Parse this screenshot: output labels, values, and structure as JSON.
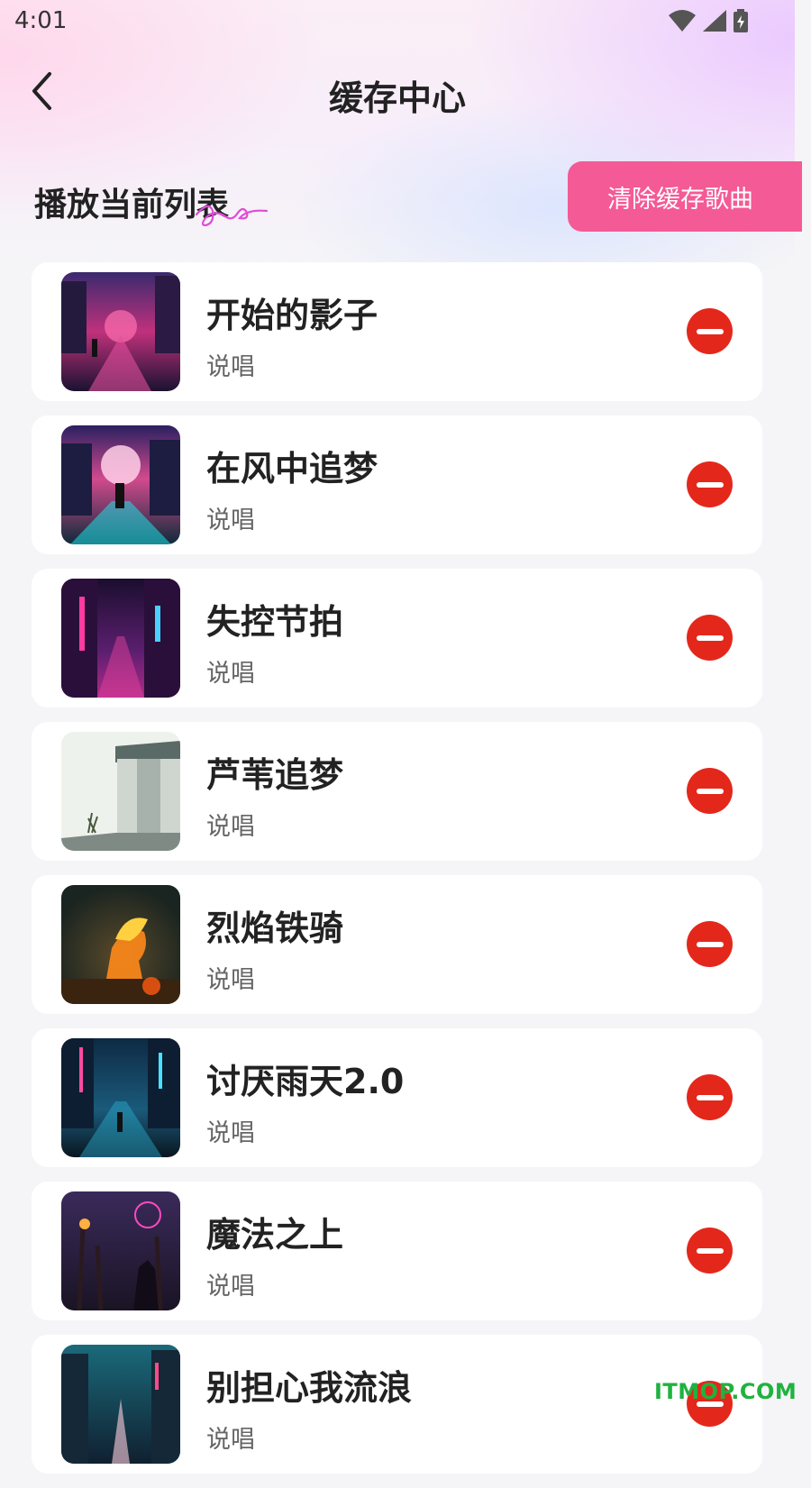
{
  "status": {
    "time": "4:01"
  },
  "header": {
    "title": "缓存中心"
  },
  "section": {
    "title": "播放当前列表",
    "clear_label": "清除缓存歌曲"
  },
  "songs": [
    {
      "title": "开始的影子",
      "subtitle": "说唱"
    },
    {
      "title": "在风中追梦",
      "subtitle": "说唱"
    },
    {
      "title": "失控节拍",
      "subtitle": "说唱"
    },
    {
      "title": "芦苇追梦",
      "subtitle": "说唱"
    },
    {
      "title": "烈焰铁骑",
      "subtitle": "说唱"
    },
    {
      "title": "讨厌雨天2.0",
      "subtitle": "说唱"
    },
    {
      "title": "魔法之上",
      "subtitle": "说唱"
    },
    {
      "title": "别担心我流浪",
      "subtitle": "说唱"
    }
  ],
  "watermark": "ITMOP.COM",
  "colors": {
    "accent": "#f45a95",
    "remove": "#e3281b"
  }
}
